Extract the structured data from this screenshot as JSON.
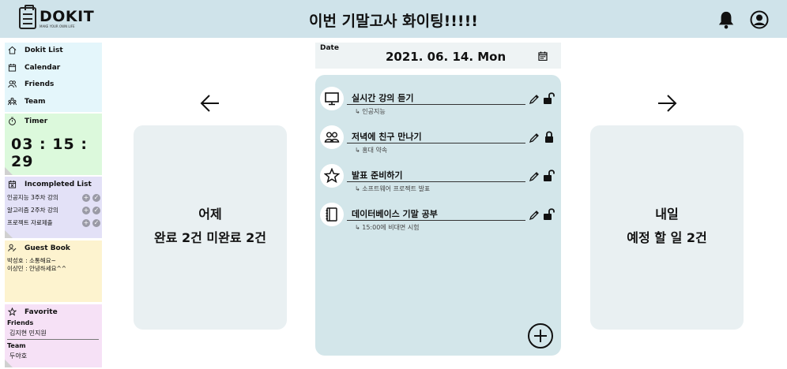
{
  "header": {
    "logo_name": "DOKIT",
    "logo_tagline": "MAKE YOUR OWN LIFE",
    "title": "이번 기말고사 화이팅!!!!!",
    "bell_icon": "bell-icon",
    "user_icon": "user-circle-icon"
  },
  "nav": {
    "items": [
      {
        "label": "Dokit List",
        "icon": "home-icon"
      },
      {
        "label": "Calendar",
        "icon": "calendar-icon"
      },
      {
        "label": "Friends",
        "icon": "friends-icon"
      },
      {
        "label": "Team",
        "icon": "team-icon"
      }
    ]
  },
  "timer": {
    "title": "Timer",
    "value": "03 : 15 : 29"
  },
  "incompleted": {
    "title": "Incompleted List",
    "items": [
      {
        "label": "인공지능 3주차 강의"
      },
      {
        "label": "알고리즘 2주차 강의"
      },
      {
        "label": "프로젝트 자료제출"
      }
    ]
  },
  "guestbook": {
    "title": "Guest Book",
    "entries": [
      "박성호 : 소통해요~",
      "이상민 : 안녕하세요^^"
    ]
  },
  "favorite": {
    "title": "Favorite",
    "friends_label": "Friends",
    "friends": "김지현    민지원",
    "team_label": "Team",
    "team": "두야호"
  },
  "yesterday": {
    "line1": "어제",
    "line2": "완료 2건 미완료 2건"
  },
  "tomorrow": {
    "line1": "내일",
    "line2": "예정 할 일 2건"
  },
  "date": {
    "label": "Date",
    "value": "2021. 06. 14. Mon"
  },
  "tasks": [
    {
      "title": "실시간 강의 듣기",
      "sub": "↳ 인공지능",
      "icon": "monitor-icon",
      "locked": false
    },
    {
      "title": "저녁에 친구 만나기",
      "sub": "↳ 홍대 약속",
      "icon": "people-icon",
      "locked": true
    },
    {
      "title": "발표 준비하기",
      "sub": "↳ 소프트웨어 프로젝트 발표",
      "icon": "star-icon",
      "locked": false
    },
    {
      "title": "데이터베이스 기말 공부",
      "sub": "↳ 15:00에 비대면 시험",
      "icon": "notebook-icon",
      "locked": false
    }
  ],
  "colors": {
    "header_bg": "#cfe3ea",
    "main_bg": "#d3e6ea",
    "panel_bg": "#e9f0f2"
  }
}
